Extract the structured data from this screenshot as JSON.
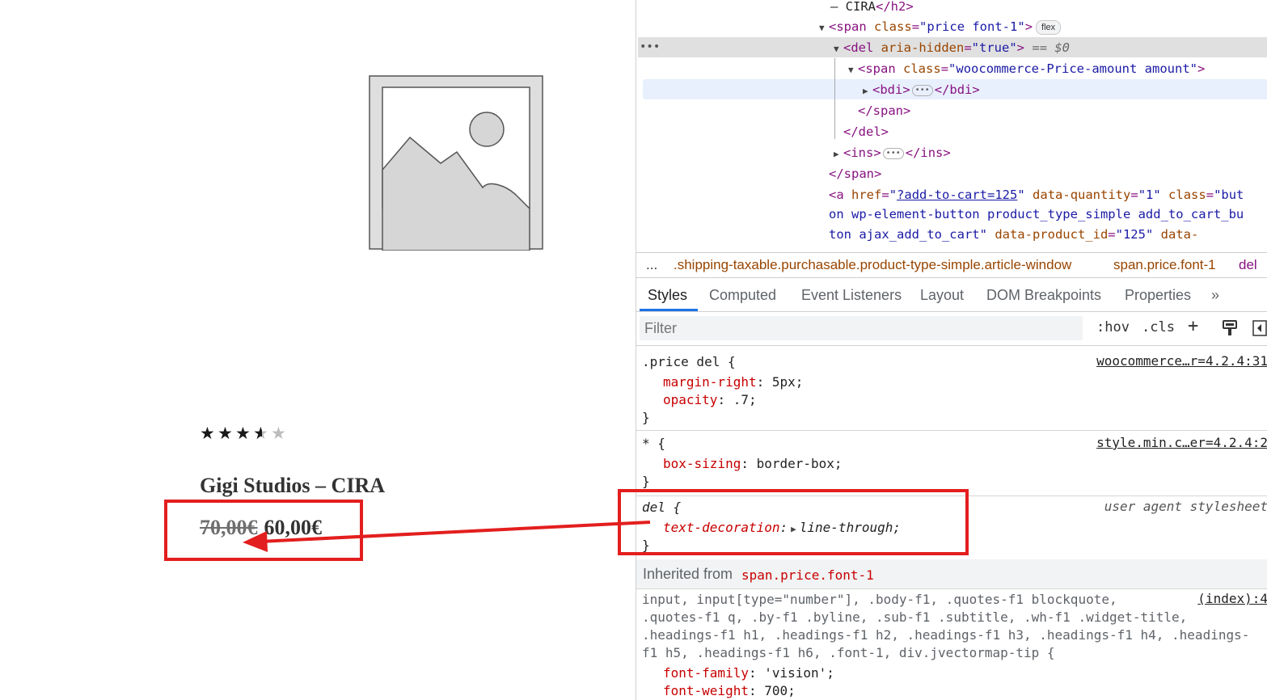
{
  "product": {
    "rating": 3.5,
    "rating_max": 5,
    "title": "Gigi Studios – CIRA",
    "old_price": "70,00€",
    "new_price": "60,00€"
  },
  "dom_tree": {
    "lines": [
      "– CIRA</h2>",
      "<span class=\"price font-1\">",
      "<del aria-hidden=\"true\"> == $0",
      "<span class=\"woocommerce-Price-amount amount\">",
      "<bdi>…</bdi>",
      "</span>",
      "</del>",
      "<ins>…</ins>",
      "</span>",
      "<a href=\"?add-to-cart=125\" data-quantity=\"1\" class=\"but",
      "on wp-element-button product_type_simple add_to_cart_bu",
      "ton ajax_add_to_cart\" data-product_id=\"125\" data-"
    ],
    "badge_flex": "flex",
    "selected_marker": "== $0",
    "link_text": "?add-to-cart=125"
  },
  "breadcrumbs": {
    "more": "...",
    "item1": ".shipping-taxable.purchasable.product-type-simple.article-window",
    "item2": "span.price.font-1",
    "item3": "del"
  },
  "tabs": [
    "Styles",
    "Computed",
    "Event Listeners",
    "Layout",
    "DOM Breakpoints",
    "Properties",
    "»"
  ],
  "filter": {
    "placeholder": "Filter",
    "hov": ":hov",
    "cls": ".cls"
  },
  "styles": {
    "rule1": {
      "selector": ".price del {",
      "source": "woocommerce…r=4.2.4:31",
      "decls": [
        [
          "margin-right",
          "5px;"
        ],
        [
          "opacity",
          ".7;"
        ]
      ]
    },
    "rule2": {
      "selector": "* {",
      "source": "style.min.c…er=4.2.4:2",
      "decls": [
        [
          "box-sizing",
          "border-box;"
        ]
      ]
    },
    "rule3": {
      "selector": "del {",
      "source": "user agent stylesheet",
      "decls": [
        [
          "text-decoration",
          "line-through;"
        ]
      ]
    },
    "inherited_label": "Inherited from",
    "inherited_from": "span.price.font-1",
    "rule4": {
      "selector_lines": [
        "input, input[type=\"number\"], .body-f1, .quotes-f1 blockquote,",
        ".quotes-f1 q, .by-f1 .byline, .sub-f1 .subtitle, .wh-f1 .widget-title,",
        ".headings-f1 h1, .headings-f1 h2, .headings-f1 h3, .headings-f1 h4, .headings-",
        "f1 h5, .headings-f1 h6, .font-1, div.jvectormap-tip {"
      ],
      "source": "(index):4",
      "decls": [
        [
          "font-family",
          "'vision';"
        ],
        [
          "font-weight",
          "700;"
        ]
      ]
    },
    "close_brace": "}"
  },
  "colors": {
    "annotation_red": "#e31e1e",
    "active_tab": "#1a73e8"
  }
}
